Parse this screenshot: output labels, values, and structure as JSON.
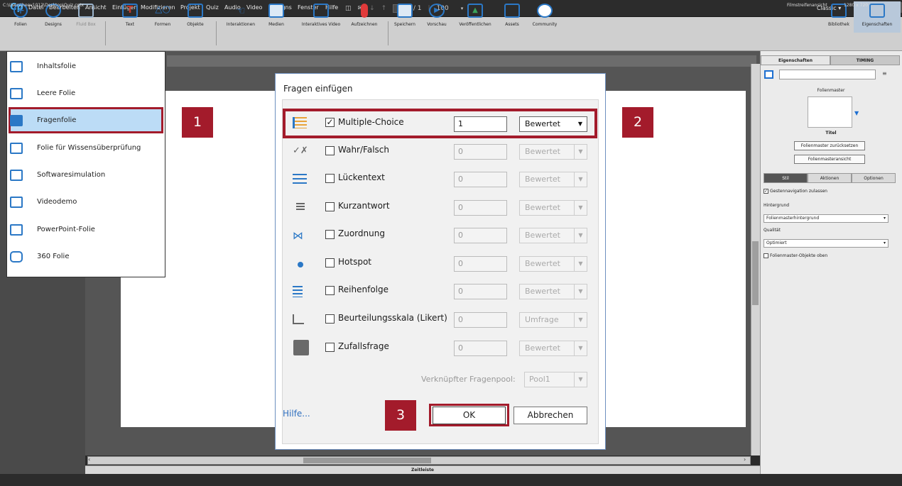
{
  "menubar": {
    "logo": "Cp",
    "items": [
      "Datei",
      "Bearbeiten",
      "Ansicht",
      "Einfügen",
      "Modifizieren",
      "Projekt",
      "Quiz",
      "Audio",
      "Video",
      "Designs",
      "Fenster",
      "Hilfe"
    ],
    "page_current": "1",
    "page_total": "/ 1",
    "zoom": "100",
    "workspace": "Classic"
  },
  "toolbar": {
    "folien": "Folien",
    "designs": "Designs",
    "fluid_box": "Fluid Box",
    "text": "Text",
    "formen": "Formen",
    "objekte": "Objekte",
    "interaktionen": "Interaktionen",
    "medien": "Medien",
    "interaktives_video": "Interaktives Video",
    "aufzeichnen": "Aufzeichnen",
    "speichern": "Speichern",
    "vorschau": "Vorschau",
    "veroeffentlichen": "Veröffentlichen",
    "assets": "Assets",
    "community": "Community",
    "bibliothek": "Bibliothek",
    "eigenschaften": "Eigenschaften"
  },
  "slides_menu": {
    "items": [
      {
        "label": "Inhaltsfolie",
        "icon": "content-slide-icon"
      },
      {
        "label": "Leere Folie",
        "icon": "blank-slide-icon"
      },
      {
        "label": "Fragenfolie",
        "icon": "question-slide-icon"
      },
      {
        "label": "Folie für Wissensüberprüfung",
        "icon": "knowledge-check-icon"
      },
      {
        "label": "Softwaresimulation",
        "icon": "software-simulation-icon"
      },
      {
        "label": "Videodemo",
        "icon": "video-demo-icon"
      },
      {
        "label": "PowerPoint-Folie",
        "icon": "powerpoint-slide-icon"
      },
      {
        "label": "360 Folie",
        "icon": "360-slide-icon"
      }
    ],
    "selected": "Fragenfolie"
  },
  "dialog": {
    "title": "Fragen einfügen",
    "questions": [
      {
        "label": "Multiple-Choice",
        "checked": true,
        "count": "1",
        "type": "Bewertet",
        "icon": "multiple-choice-icon"
      },
      {
        "label": "Wahr/Falsch",
        "checked": false,
        "count": "0",
        "type": "Bewertet",
        "icon": "true-false-icon"
      },
      {
        "label": "Lückentext",
        "checked": false,
        "count": "0",
        "type": "Bewertet",
        "icon": "fill-blank-icon"
      },
      {
        "label": "Kurzantwort",
        "checked": false,
        "count": "0",
        "type": "Bewertet",
        "icon": "short-answer-icon"
      },
      {
        "label": "Zuordnung",
        "checked": false,
        "count": "0",
        "type": "Bewertet",
        "icon": "matching-icon"
      },
      {
        "label": "Hotspot",
        "checked": false,
        "count": "0",
        "type": "Bewertet",
        "icon": "hotspot-icon"
      },
      {
        "label": "Reihenfolge",
        "checked": false,
        "count": "0",
        "type": "Bewertet",
        "icon": "sequence-icon"
      },
      {
        "label": "Beurteilungsskala (Likert)",
        "checked": false,
        "count": "0",
        "type": "Umfrage",
        "icon": "likert-icon"
      },
      {
        "label": "Zufallsfrage",
        "checked": false,
        "count": "0",
        "type": "Bewertet",
        "icon": "random-question-icon"
      }
    ],
    "pool_label": "Verknüpfter Fragenpool:",
    "pool_value": "Pool1",
    "help": "Hilfe...",
    "ok": "OK",
    "cancel": "Abbrechen"
  },
  "callouts": [
    "1",
    "2",
    "3"
  ],
  "properties": {
    "tab_eigenschaften": "Eigenschaften",
    "tab_timing": "TIMING",
    "folienmaster": "Folienmaster",
    "thumb_title": "Titel",
    "btn_reset": "Folienmaster zurücksetzen",
    "btn_view": "Folienmasteransicht",
    "tab_stil": "Stil",
    "tab_aktionen": "Aktionen",
    "tab_optionen": "Optionen",
    "gesten": "Gestennavigation zulassen",
    "hintergrund_label": "Hintergrund",
    "hintergrund_value": "Folienmasterhintergrund",
    "qualitaet_label": "Qualität",
    "qualitaet_value": "Optimiert",
    "master_objekte": "Folienmaster-Objekte oben"
  },
  "timeline": "Zeitleiste",
  "status": {
    "path": "C:\\Users\\heev1012\\Desktop\\Quiz.cptx",
    "filmstrip": "Filmstreifenansicht",
    "size": "1280 x 720"
  },
  "colors": {
    "accent": "#a31b2b",
    "blue": "#2b78c6"
  }
}
